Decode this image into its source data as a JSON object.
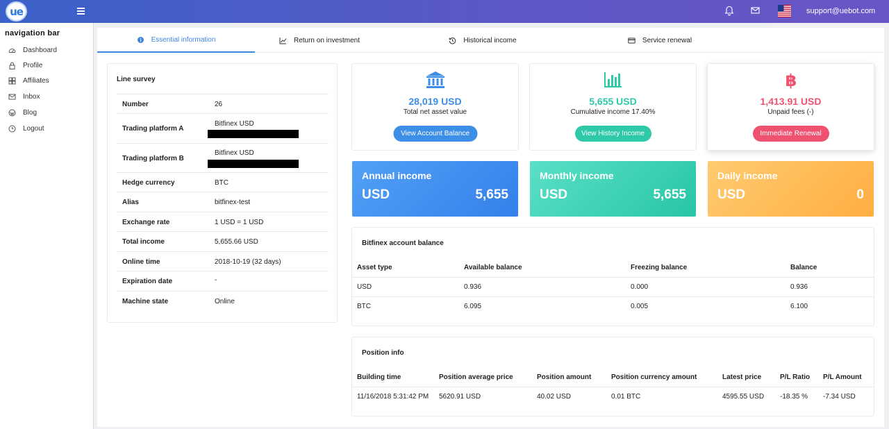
{
  "app": {
    "logo_text": "ue",
    "support_email": "support@uebot.com"
  },
  "sidebar": {
    "title": "navigation bar",
    "items": [
      {
        "label": "Dashboard",
        "icon": "dashboard-icon"
      },
      {
        "label": "Profile",
        "icon": "lock-icon"
      },
      {
        "label": "Affiliates",
        "icon": "affiliates-icon"
      },
      {
        "label": "Inbox",
        "icon": "mail-icon"
      },
      {
        "label": "Blog",
        "icon": "wordpress-icon"
      },
      {
        "label": "Logout",
        "icon": "power-icon"
      }
    ]
  },
  "tabs": [
    {
      "label": "Essential information",
      "icon": "info-icon",
      "active": true
    },
    {
      "label": "Return on investment",
      "icon": "chart-line-icon",
      "active": false
    },
    {
      "label": "Historical income",
      "icon": "history-icon",
      "active": false
    },
    {
      "label": "Service renewal",
      "icon": "credit-card-icon",
      "active": false
    }
  ],
  "line_survey": {
    "title": "Line survey",
    "rows": [
      {
        "label": "Number",
        "value": "26"
      },
      {
        "label": "Trading platform A",
        "value": "Bitfinex USD"
      },
      {
        "label": "Trading platform B",
        "value": "Bitfinex USD"
      },
      {
        "label": "Hedge currency",
        "value": "BTC"
      },
      {
        "label": "Alias",
        "value": "bitfinex-test"
      },
      {
        "label": "Exchange rate",
        "value": "1 USD = 1 USD"
      },
      {
        "label": "Total income",
        "value": "5,655.66 USD"
      },
      {
        "label": "Online time",
        "value": "2018-10-19 (32 days)"
      },
      {
        "label": "Expiration date",
        "value": "-"
      },
      {
        "label": "Machine state",
        "value": "Online"
      }
    ]
  },
  "summary_cards": [
    {
      "icon": "bank-icon",
      "amount": "28,019 USD",
      "label": "Total net asset value",
      "button": "View Account Balance",
      "color": "#3d8ee6"
    },
    {
      "icon": "bar-chart-icon",
      "amount": "5,655 USD",
      "label": "Cumulative income 17.40%",
      "button": "View History Income",
      "color": "#2ec9a7"
    },
    {
      "icon": "bitcoin-icon",
      "amount": "1,413.91 USD",
      "label": "Unpaid fees (-)",
      "button": "Immediate Renewal",
      "color": "#ef5270"
    }
  ],
  "income_cards": [
    {
      "title": "Annual income",
      "currency": "USD",
      "value": "5,655"
    },
    {
      "title": "Monthly income",
      "currency": "USD",
      "value": "5,655"
    },
    {
      "title": "Daily income",
      "currency": "USD",
      "value": "0"
    }
  ],
  "account_balance": {
    "title": "Bitfinex account balance",
    "headers": [
      "Asset type",
      "Available balance",
      "Freezing balance",
      "Balance"
    ],
    "rows": [
      [
        "USD",
        "0.936",
        "0.000",
        "0.936"
      ],
      [
        "BTC",
        "6.095",
        "0.005",
        "6.100"
      ]
    ]
  },
  "position_info": {
    "title": "Position info",
    "headers": [
      "Building time",
      "Position average price",
      "Position amount",
      "Position currency amount",
      "Latest price",
      "P/L Ratio",
      "P/L Amount"
    ],
    "rows": [
      [
        "11/16/2018 5:31:42 PM",
        "5620.91 USD",
        "40.02 USD",
        "0.01 BTC",
        "4595.55 USD",
        "-18.35 %",
        "-7.34 USD"
      ]
    ]
  }
}
